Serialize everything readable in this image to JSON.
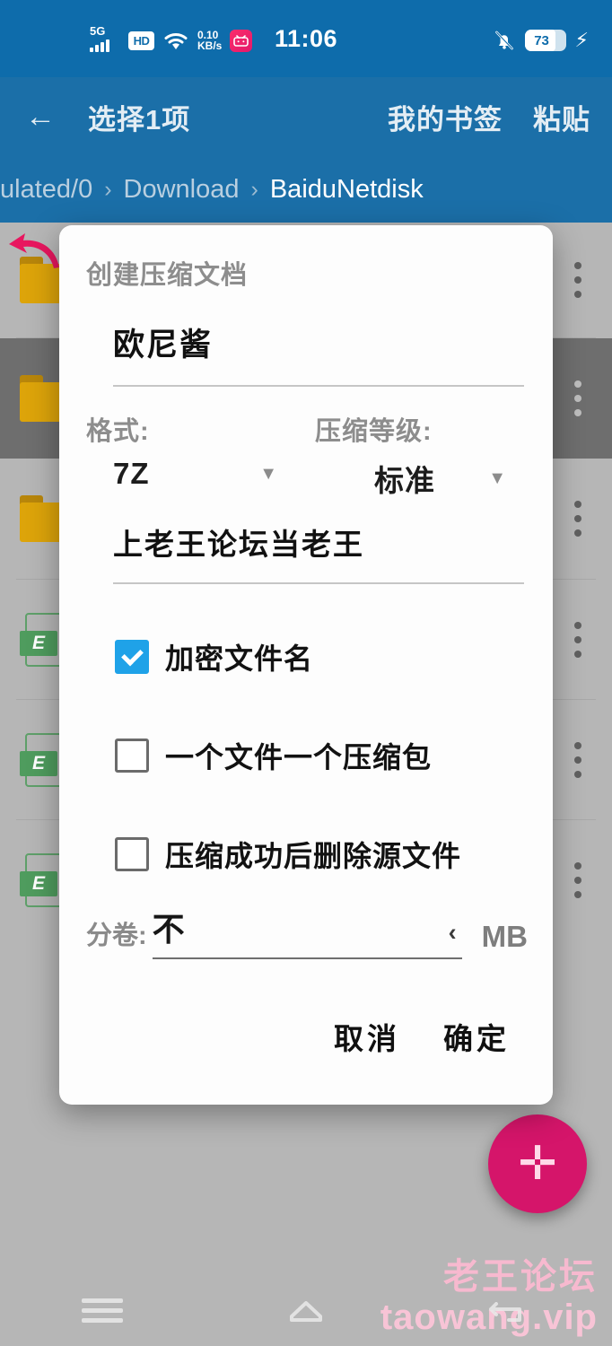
{
  "statusbar": {
    "network_label": "5G",
    "hd_label": "HD",
    "speed_value": "0.10",
    "speed_unit": "KB/s",
    "app_icon": "bilibili-icon",
    "wifi_icon": "wifi-icon",
    "mute_icon": "mute-bell-icon",
    "clock": "11:06",
    "battery_percent": "73",
    "charging_icon": "bolt-icon"
  },
  "appbar": {
    "back_icon": "back-arrow-icon",
    "title": "选择1项",
    "actions": [
      {
        "label": "我的书签",
        "name": "my-bookmarks-button"
      },
      {
        "label": "粘贴",
        "name": "paste-button"
      }
    ]
  },
  "breadcrumb": {
    "separator": "›",
    "crumbs": [
      "ulated/0",
      "Download",
      "BaiduNetdisk"
    ]
  },
  "filelist": {
    "rows": [
      {
        "icon": "folder-icon",
        "name": "",
        "selected": false,
        "menu": "overflow-menu-icon"
      },
      {
        "icon": "folder-icon",
        "name": "",
        "selected": true,
        "menu": "overflow-menu-icon"
      },
      {
        "icon": "folder-icon",
        "name": "",
        "selected": false,
        "menu": "overflow-menu-icon"
      },
      {
        "icon": "excel-file-icon",
        "name": "",
        "selected": false,
        "menu": "overflow-menu-icon"
      },
      {
        "icon": "excel-file-icon",
        "name": "",
        "selected": false,
        "menu": "overflow-menu-icon"
      },
      {
        "icon": "excel-file-icon",
        "name": "",
        "selected": false,
        "menu": "overflow-menu-icon"
      }
    ]
  },
  "dialog": {
    "title": "创建压缩文档",
    "archive_name": "欧尼酱",
    "archive_name_placeholder": "",
    "format": {
      "label": "格式:",
      "value": "7Z",
      "caret": "chevron-down-icon"
    },
    "level": {
      "label": "压缩等级:",
      "value": "标准",
      "caret": "chevron-down-icon"
    },
    "password": {
      "value": "上老王论坛当老王",
      "placeholder": ""
    },
    "checkboxes": [
      {
        "label": "加密文件名",
        "checked": true,
        "name": "encrypt-filenames-checkbox"
      },
      {
        "label": "一个文件一个压缩包",
        "checked": false,
        "name": "one-archive-per-file-checkbox"
      },
      {
        "label": "压缩成功后删除源文件",
        "checked": false,
        "name": "delete-source-after-compress-checkbox"
      }
    ],
    "split": {
      "label": "分卷:",
      "value": "不",
      "chevron": "chevron-left-icon",
      "unit": "MB"
    },
    "buttons": {
      "cancel": "取消",
      "confirm": "确定"
    }
  },
  "fab": {
    "icon": "plus-icon",
    "color": "#d5156a"
  },
  "watermark": {
    "line1": "老王论坛",
    "line2": "taowang.vip"
  },
  "navbar": {
    "recents": "recents-menu-icon",
    "home": "home-icon",
    "back": "back-nav-icon"
  },
  "colors": {
    "status_bar": "#0e6cab",
    "app_bar": "#1b6fa8",
    "accent_checkbox": "#1fa2e8",
    "fab": "#d5156a",
    "watermark": "#f7b9cf"
  }
}
